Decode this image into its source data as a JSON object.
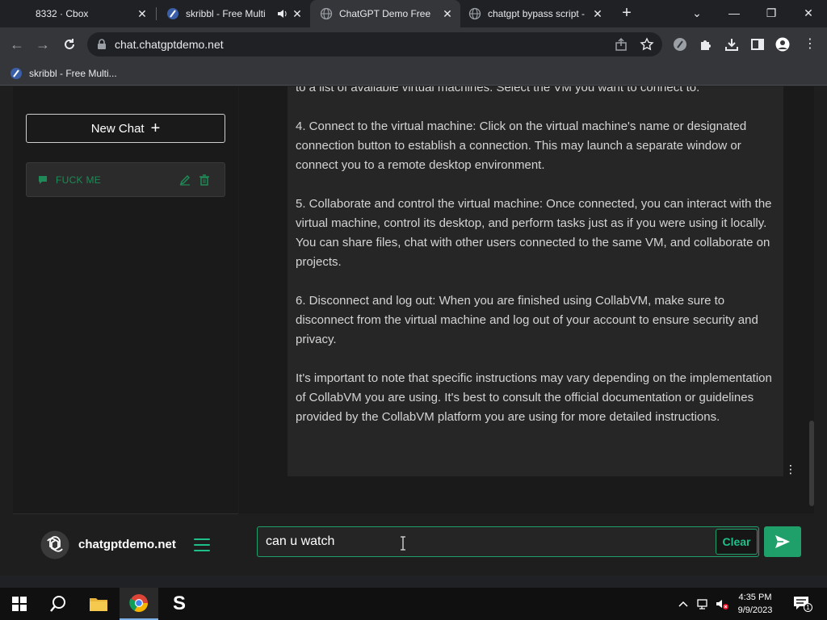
{
  "browser": {
    "tabs": [
      {
        "title": "8332 · Cbox",
        "active": false
      },
      {
        "title": "skribbl - Free Multi",
        "active": false
      },
      {
        "title": "ChatGPT Demo Free",
        "active": true
      },
      {
        "title": "chatgpt bypass script -",
        "active": false
      }
    ],
    "url": "chat.chatgptdemo.net",
    "bookmarks": [
      {
        "label": "skribbl - Free Multi..."
      }
    ]
  },
  "sidebar": {
    "new_chat_label": "New Chat",
    "chats": [
      {
        "label": "FUCK ME"
      }
    ],
    "brand": "chatgptdemo.net"
  },
  "conversation": {
    "paragraphs": [
      "to a list of available virtual machines. Select the VM you want to connect to.",
      "4. Connect to the virtual machine: Click on the virtual machine's name or designated connection button to establish a connection. This may launch a separate window or connect you to a remote desktop environment.",
      "5. Collaborate and control the virtual machine: Once connected, you can interact with the virtual machine, control its desktop, and perform tasks just as if you were using it locally. You can share files, chat with other users connected to the same VM, and collaborate on projects.",
      "6. Disconnect and log out: When you are finished using CollabVM, make sure to disconnect from the virtual machine and log out of your account to ensure security and privacy.",
      "It's important to note that specific instructions may vary depending on the implementation of CollabVM you are using. It's best to consult the official documentation or guidelines provided by the CollabVM platform you are using for more detailed instructions."
    ]
  },
  "composer": {
    "value": "can u watch",
    "clear_label": "Clear"
  },
  "taskbar": {
    "time": "4:35 PM",
    "date": "9/9/2023",
    "notification_count": "1"
  },
  "colors": {
    "accent": "#1fa06a",
    "chat_label": "#1f8a57"
  }
}
